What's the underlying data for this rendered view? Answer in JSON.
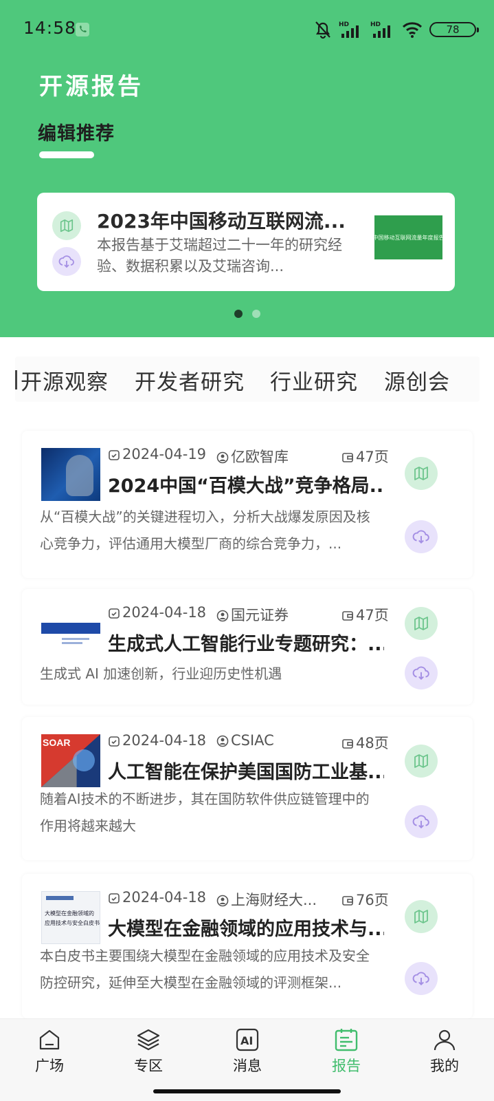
{
  "status_bar": {
    "time": "14:58",
    "battery": "78",
    "icons": [
      "phone-icon",
      "mute-bell-icon",
      "hd-signal-icon",
      "hd-signal-icon",
      "wifi-icon",
      "battery-icon"
    ]
  },
  "header": {
    "title": "开源报告",
    "section_tab": "编辑推荐"
  },
  "featured": {
    "title": "2023年中国移动互联网流...",
    "description": "本报告基于艾瑞超过二十一年的研究经验、数据积累以及艾瑞咨询...",
    "thumbnail_text": "中国移动互联网流量年度报告",
    "icons": [
      "map-icon",
      "cloud-download-icon"
    ]
  },
  "carousel": {
    "count": 2,
    "active_index": 0
  },
  "categories": {
    "items": [
      "开源观察",
      "开发者研究",
      "行业研究",
      "源创会"
    ]
  },
  "reports": [
    {
      "date": "2024-04-19",
      "source": "亿欧智库",
      "pages": "47页",
      "title": "2024中国“百模大战”竞争格局...",
      "description": "从“百模大战”的关键进程切入，分析大战爆发原因及核心竞争力，评估通用大模型厂商的综合竞争力，..."
    },
    {
      "date": "2024-04-18",
      "source": "国元证券",
      "pages": "47页",
      "title": "生成式人工智能行业专题研究：...",
      "description": "生成式 AI 加速创新，行业迎历史性机遇"
    },
    {
      "date": "2024-04-18",
      "source": "CSIAC",
      "pages": "48页",
      "title": "人工智能在保护美国国防工业基...",
      "description": "随着AI技术的不断进步，其在国防软件供应链管理中的作用将越来越大",
      "thumbnail_label": "SOAR"
    },
    {
      "date": "2024-04-18",
      "source": "上海财经大...",
      "pages": "76页",
      "title": "大模型在金融领域的应用技术与...",
      "description": "本白皮书主要围绕大模型在金融领域的应用技术及安全防控研究，延伸至大模型在金融领域的评测框架...",
      "thumbnail_lines": [
        "大模型在金融领域的",
        "应用技术与安全白皮书"
      ]
    }
  ],
  "bottom_nav": {
    "items": [
      {
        "label": "广场",
        "icon": "home-icon"
      },
      {
        "label": "专区",
        "icon": "layers-icon"
      },
      {
        "label": "消息",
        "icon": "ai-icon"
      },
      {
        "label": "报告",
        "icon": "report-icon"
      },
      {
        "label": "我的",
        "icon": "user-icon"
      }
    ],
    "active_label": "报告"
  },
  "colors": {
    "brand_green": "#4fc87c",
    "active_nav": "#41bd6d",
    "map_button_bg": "#d3f0dc",
    "download_button_bg": "#e8e2fb"
  }
}
